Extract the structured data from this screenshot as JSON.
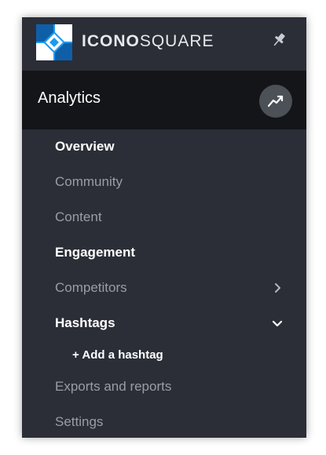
{
  "brand": {
    "name_bold": "ICONO",
    "name_light": "SQUARE",
    "logo_icon": "iconosquare-logo-icon",
    "pin_icon": "pin-icon",
    "accent_color": "#1e9bf0"
  },
  "section": {
    "title": "Analytics",
    "icon": "trend-line-icon"
  },
  "nav": {
    "overview": "Overview",
    "community": "Community",
    "content": "Content",
    "engagement": "Engagement",
    "competitors": "Competitors",
    "hashtags": "Hashtags",
    "add_hashtag": "+ Add a hashtag",
    "exports": "Exports and reports",
    "settings": "Settings"
  },
  "colors": {
    "sidebar_bg": "#2b2e37",
    "header_bg": "#141519",
    "active_text": "#ffffff",
    "inactive_text": "#9a9da6"
  }
}
